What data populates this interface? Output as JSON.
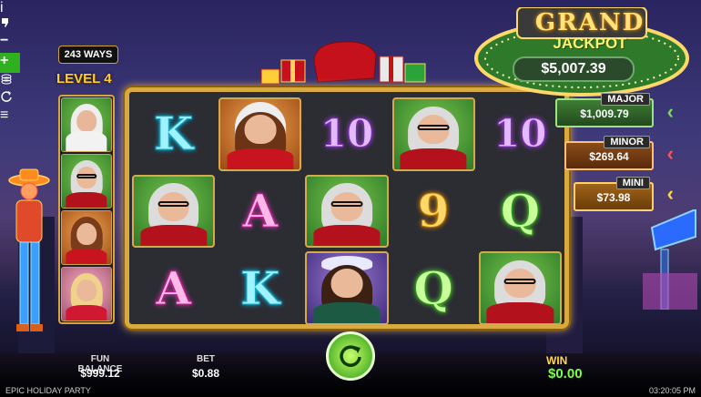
{
  "game": {
    "ways": "243 WAYS",
    "level": "LEVEL 4",
    "name": "EPIC HOLIDAY PARTY",
    "clock": "03:20:05 PM"
  },
  "jackpots": {
    "grand_title": "GRAND",
    "grand_subtitle": "JACKPOT",
    "grand_value": "$5,007.39",
    "major_label": "MAJOR",
    "major_value": "$1,009.79",
    "minor_label": "MINOR",
    "minor_value": "$269.64",
    "mini_label": "MINI",
    "mini_value": "$73.98",
    "colors": {
      "major": "#7ed957",
      "minor": "#ff5555",
      "mini": "#ffd84a"
    }
  },
  "sidebar": [
    {
      "kind": "santa",
      "bg": "green"
    },
    {
      "kind": "mrs-claus",
      "bg": "green"
    },
    {
      "kind": "elf-girl",
      "bg": "orange"
    },
    {
      "kind": "blonde-girl",
      "bg": "pink"
    }
  ],
  "reels": [
    [
      "K",
      "portrait:elf-girl",
      "10",
      "portrait:mrs-claus",
      "10"
    ],
    [
      "portrait:mrs-claus",
      "A",
      "portrait:mrs-claus",
      "9",
      "Q"
    ],
    [
      "A",
      "K",
      "portrait:brunette",
      "Q",
      "portrait:mrs-claus"
    ]
  ],
  "bottom": {
    "info_icon": "i",
    "balance_label": "FUN BALANCE",
    "balance_value": "$999.12",
    "bet_label": "BET",
    "bet_value": "$0.88",
    "minus": "−",
    "plus": "+",
    "win_label": "WIN",
    "win_value": "$0.00",
    "menu_icon": "≡"
  }
}
